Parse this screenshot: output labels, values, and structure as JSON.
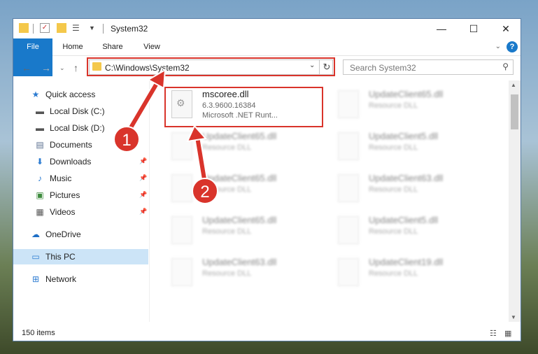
{
  "window": {
    "title": "System32"
  },
  "ribbon": {
    "tabs": [
      "File",
      "Home",
      "Share",
      "View"
    ],
    "help": "?"
  },
  "address": {
    "path": "C:\\Windows\\System32",
    "search_placeholder": "Search System32"
  },
  "nav": {
    "quick_access": "Quick access",
    "items": [
      "Local Disk (C:)",
      "Local Disk (D:)",
      "Documents",
      "Downloads",
      "Music",
      "Pictures",
      "Videos"
    ],
    "onedrive": "OneDrive",
    "thispc": "This PC",
    "network": "Network"
  },
  "files": [
    {
      "name": "mscoree.dll",
      "line1": "6.3.9600.16384",
      "line2": "Microsoft .NET Runt..."
    },
    {
      "name": "UpdateClient65.dll",
      "line1": "Resource DLL"
    },
    {
      "name": "UpdateClient65.dll",
      "line1": "Resource DLL"
    },
    {
      "name": "UpdateClient5.dll",
      "line1": "Resource DLL"
    },
    {
      "name": "UpdateClient65.dll",
      "line1": "Resource DLL"
    },
    {
      "name": "UpdateClient63.dll",
      "line1": "Resource DLL"
    },
    {
      "name": "UpdateClient65.dll",
      "line1": "Resource DLL"
    },
    {
      "name": "UpdateClient5.dll",
      "line1": "Resource DLL"
    },
    {
      "name": "UpdateClient63.dll",
      "line1": "Resource DLL"
    },
    {
      "name": "UpdateClient19.dll",
      "line1": "Resource DLL"
    }
  ],
  "status": {
    "count": "150 items"
  },
  "badges": [
    "1",
    "2"
  ]
}
